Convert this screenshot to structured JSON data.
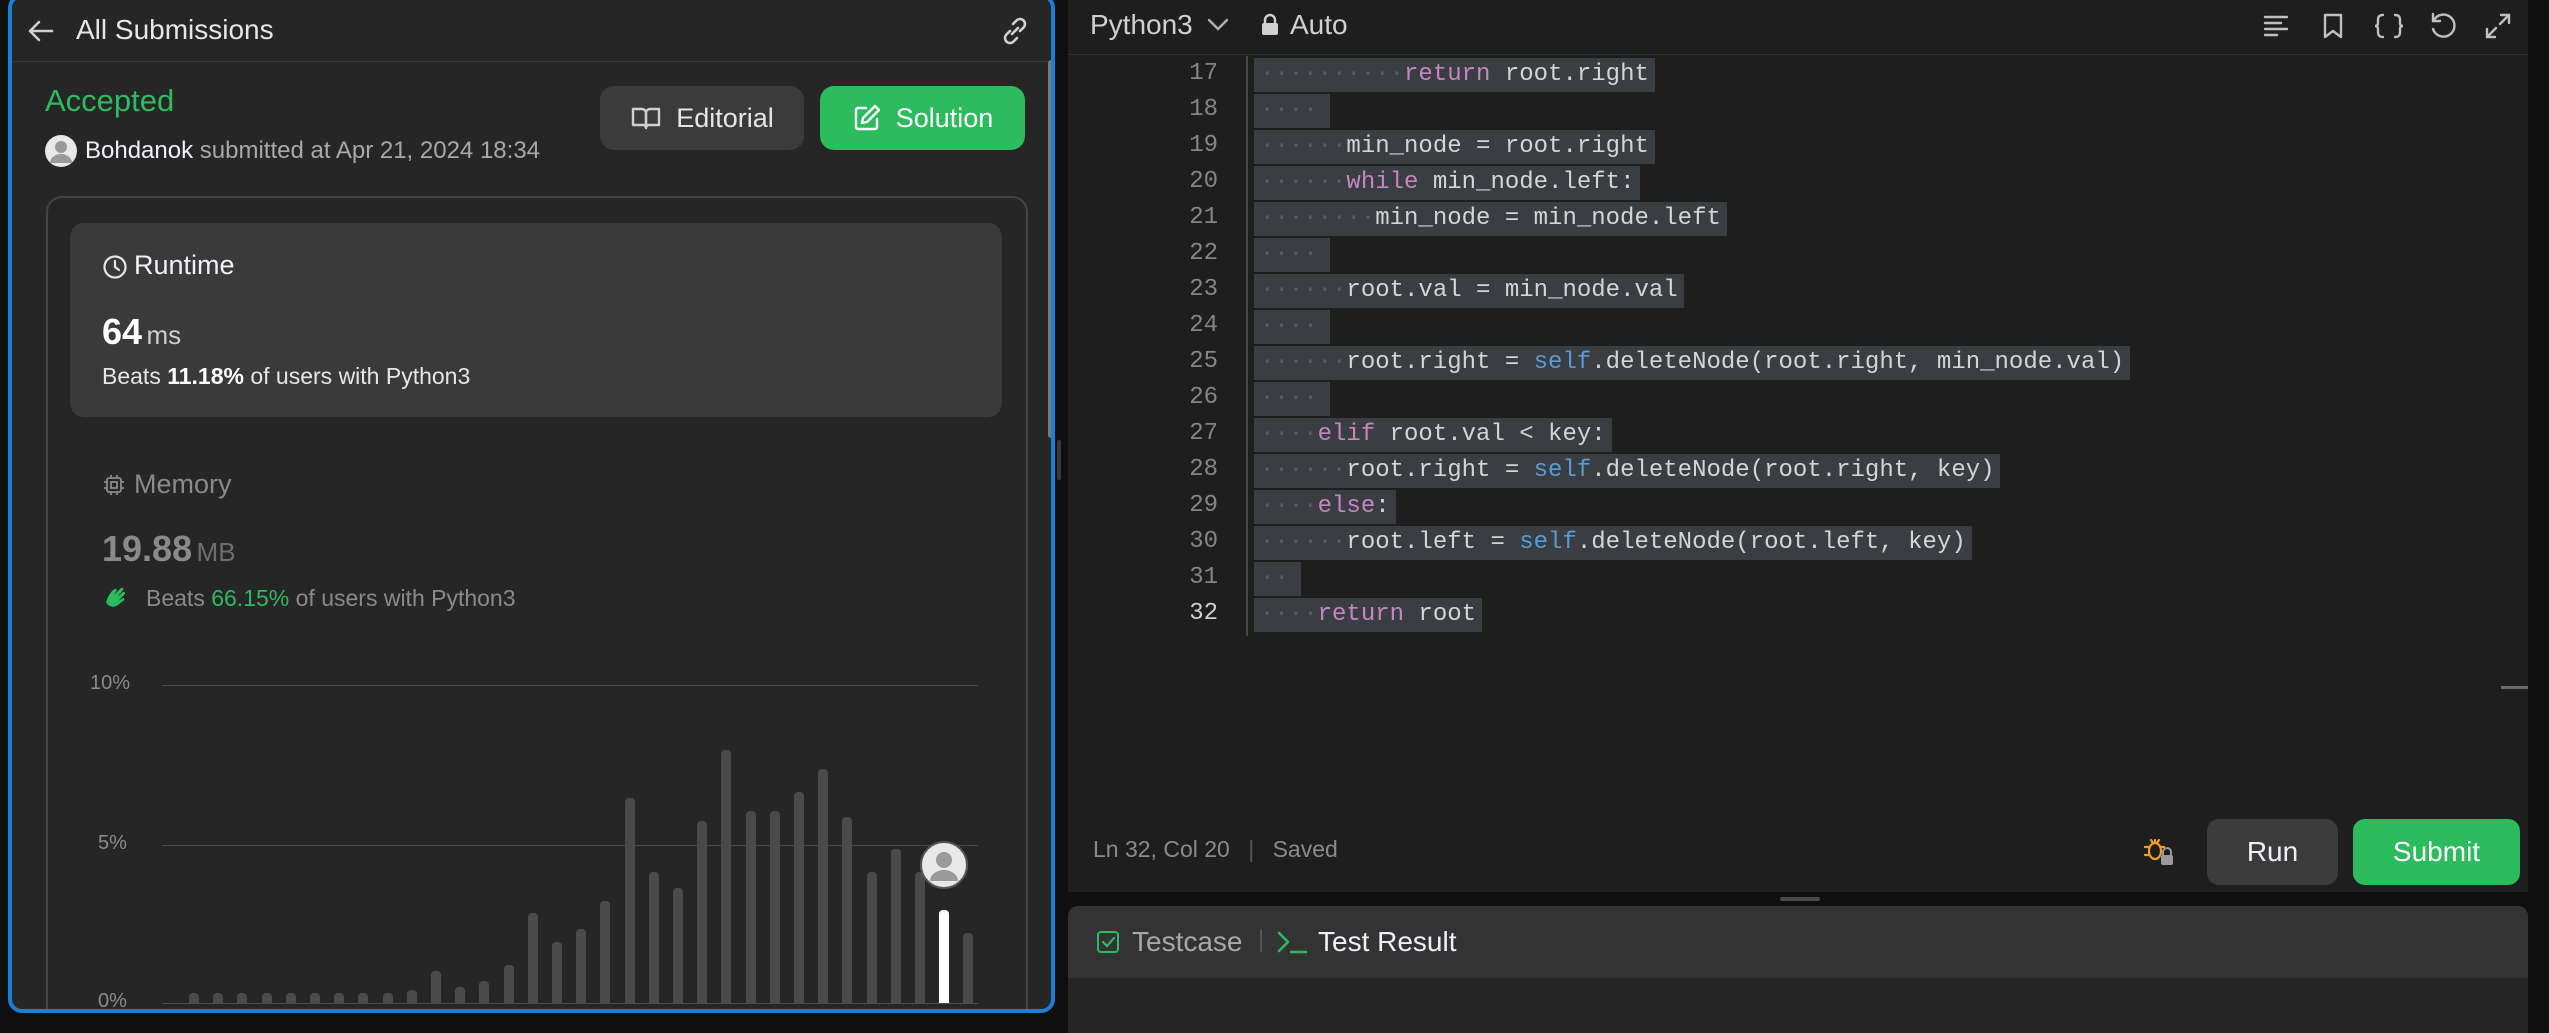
{
  "left_panel": {
    "back_label": "All Submissions",
    "status": "Accepted",
    "author": "Bohdanok",
    "submitted_text": "submitted at Apr 21, 2024 18:34",
    "editorial_label": "Editorial",
    "solution_label": "Solution",
    "runtime": {
      "title": "Runtime",
      "value": "64",
      "unit": "ms",
      "beats_prefix": "Beats",
      "beats_percent": "11.18%",
      "beats_suffix": "of users with Python3"
    },
    "memory": {
      "title": "Memory",
      "value": "19.88",
      "unit": "MB",
      "beats_prefix": "Beats",
      "beats_percent": "66.15%",
      "beats_suffix": "of users with Python3"
    },
    "chart": {
      "y_labels": [
        "10%",
        "5%",
        "0%"
      ],
      "bar_values": [
        0.3,
        0.3,
        0.3,
        0.3,
        0.3,
        0.3,
        0.3,
        0.3,
        0.3,
        0.4,
        1.0,
        0.5,
        0.7,
        1.2,
        2.8,
        1.9,
        2.3,
        3.2,
        6.4,
        4.1,
        3.6,
        5.7,
        7.9,
        6.0,
        6.0,
        6.6,
        7.3,
        5.8,
        4.1,
        4.8,
        4.1,
        2.9,
        2.2
      ],
      "user_bar_index": 31
    }
  },
  "editor": {
    "language": "Python3",
    "mode": "Auto",
    "status_position": "Ln 32, Col 20",
    "status_saved": "Saved",
    "run_label": "Run",
    "submit_label": "Submit",
    "lines": [
      {
        "n": "17",
        "tokens": [
          {
            "t": "return",
            "c": "kw"
          },
          {
            "t": " root.right",
            "c": "plain"
          }
        ]
      },
      {
        "n": "18",
        "tokens": []
      },
      {
        "n": "19",
        "tokens": [
          {
            "t": "min_node = root.right",
            "c": "plain"
          }
        ]
      },
      {
        "n": "20",
        "tokens": [
          {
            "t": "while",
            "c": "kw"
          },
          {
            "t": " min_node.left:",
            "c": "plain"
          }
        ]
      },
      {
        "n": "21",
        "tokens": [
          {
            "t": "min_node = min_node.left",
            "c": "plain"
          }
        ]
      },
      {
        "n": "22",
        "tokens": []
      },
      {
        "n": "23",
        "tokens": [
          {
            "t": "root.val = min_node.val",
            "c": "plain"
          }
        ]
      },
      {
        "n": "24",
        "tokens": []
      },
      {
        "n": "25",
        "tokens": [
          {
            "t": "root.right = ",
            "c": "plain"
          },
          {
            "t": "self",
            "c": "self"
          },
          {
            "t": ".deleteNode(root.right, min_node.val)",
            "c": "plain"
          }
        ]
      },
      {
        "n": "26",
        "tokens": []
      },
      {
        "n": "27",
        "tokens": [
          {
            "t": "elif",
            "c": "kw"
          },
          {
            "t": " root.val < key:",
            "c": "plain"
          }
        ]
      },
      {
        "n": "28",
        "tokens": [
          {
            "t": "root.right = ",
            "c": "plain"
          },
          {
            "t": "self",
            "c": "self"
          },
          {
            "t": ".deleteNode(root.right, key)",
            "c": "plain"
          }
        ]
      },
      {
        "n": "29",
        "tokens": [
          {
            "t": "else",
            "c": "kw"
          },
          {
            "t": ":",
            "c": "plain"
          }
        ]
      },
      {
        "n": "30",
        "tokens": [
          {
            "t": "root.left = ",
            "c": "plain"
          },
          {
            "t": "self",
            "c": "self"
          },
          {
            "t": ".deleteNode(root.left, key)",
            "c": "plain"
          }
        ]
      },
      {
        "n": "31",
        "tokens": []
      },
      {
        "n": "32",
        "tokens": [
          {
            "t": "return",
            "c": "kw"
          },
          {
            "t": " root",
            "c": "plain"
          }
        ]
      }
    ]
  },
  "bottom": {
    "testcase_label": "Testcase",
    "test_result_label": "Test Result"
  },
  "colors": {
    "accent_green": "#2cbb5d",
    "focus_blue": "#1a7fd6"
  }
}
